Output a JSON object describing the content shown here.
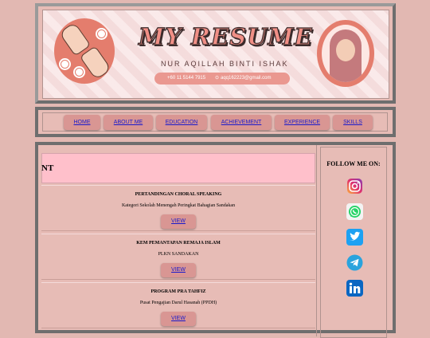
{
  "header": {
    "title_art": "MY RESUME",
    "name": "NUR AQILLAH BINTI ISHAK",
    "phone": "+60 11 5144 7915",
    "email": "aqq162223@gmail.com"
  },
  "nav": {
    "items": [
      {
        "label": "HOME"
      },
      {
        "label": "ABOUT ME"
      },
      {
        "label": "EDUCATION"
      },
      {
        "label": "ACHIEVEMENT"
      },
      {
        "label": "EXPERIENCE"
      },
      {
        "label": "SKILLS"
      }
    ]
  },
  "main": {
    "section_title": "EMENT",
    "cards": [
      {
        "title": "PERTANDINGAN CHORAL SPEAKING",
        "subtitle": "Kategori Sekolah Menengah Peringkat Bahagian Sandakan",
        "button": "VIEW"
      },
      {
        "title": "KEM PEMANTAPAN REMAJA ISLAM",
        "subtitle": "PLKN SANDAKAN",
        "button": "VIEW"
      },
      {
        "title": "PROGRAM PRA TAHFIZ",
        "subtitle": "Pusat Pengajian Darul Hasanah (PPDH)",
        "button": "VIEW"
      }
    ]
  },
  "sidebar": {
    "follow_label": "FOLLOW ME ON:",
    "socials": [
      "instagram-icon",
      "whatsapp-icon",
      "twitter-icon",
      "telegram-icon",
      "linkedin-icon"
    ]
  },
  "colors": {
    "background": "#e2b8b2",
    "frame": "#6e6e6e",
    "button": "#d99693",
    "link": "#1a1acc",
    "section_head": "#ffc0cb",
    "accent": "#e47d6d"
  }
}
